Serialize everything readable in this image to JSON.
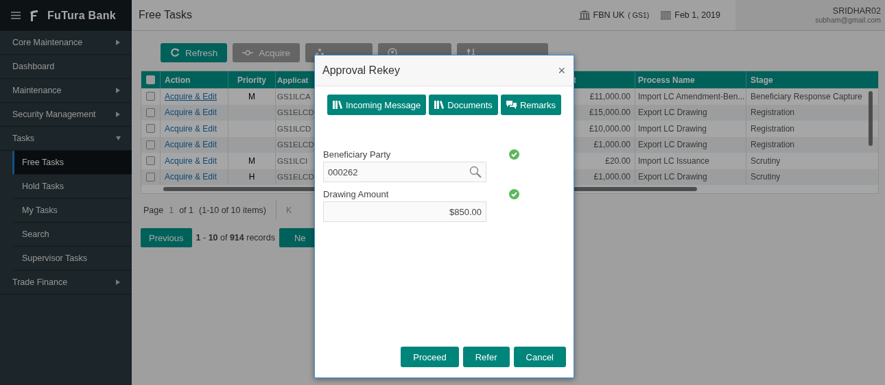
{
  "brand": {
    "name": "FuTura Bank"
  },
  "sidebar": {
    "items": [
      {
        "label": "Core Maintenance",
        "expanded": false
      },
      {
        "label": "Dashboard"
      },
      {
        "label": "Maintenance",
        "expanded": false
      },
      {
        "label": "Security Management",
        "expanded": false
      },
      {
        "label": "Tasks",
        "expanded": true,
        "children": [
          {
            "label": "Free Tasks",
            "selected": true
          },
          {
            "label": "Hold Tasks",
            "selected": false
          },
          {
            "label": "My Tasks",
            "selected": false
          },
          {
            "label": "Search",
            "selected": false
          },
          {
            "label": "Supervisor Tasks",
            "selected": false
          }
        ]
      },
      {
        "label": "Trade Finance",
        "expanded": false
      }
    ]
  },
  "header": {
    "title": "Free Tasks",
    "branch": "FBN UK",
    "branch_code": "( GS1)",
    "date": "Feb 1, 2019",
    "user": "SRIDHAR02",
    "email": "subham@gmail.com"
  },
  "toolbar": [
    {
      "label": "Refresh",
      "kind": "refresh",
      "disabled": false
    },
    {
      "label": "Acquire",
      "kind": "acquire",
      "disabled": true
    },
    {
      "kind": "delegate",
      "disabled": true
    },
    {
      "kind": "reassign",
      "disabled": true
    },
    {
      "kind": "flow",
      "disabled": true
    }
  ],
  "table": {
    "header_checked": false,
    "columns": [
      "Action",
      "Priority",
      "Applicat",
      "t",
      "Process Name",
      "Stage"
    ],
    "rows": [
      {
        "checked": false,
        "action": "Acquire & Edit",
        "priority": "M",
        "application": "GS1ILCA",
        "amount": "£11,000.00",
        "process": "Import LC Amendment-Ben...",
        "stage": "Beneficiary Response Capture"
      },
      {
        "checked": false,
        "action": "Acquire & Edit",
        "priority": "",
        "application": "GS1ELCD",
        "amount": "£15,000.00",
        "process": "Export LC Drawing",
        "stage": "Registration"
      },
      {
        "checked": false,
        "action": "Acquire & Edit",
        "priority": "",
        "application": "GS1ILCD",
        "amount": "£10,000.00",
        "process": "Import LC Drawing",
        "stage": "Registration"
      },
      {
        "checked": false,
        "action": "Acquire & Edit",
        "priority": "",
        "application": "GS1ELCD",
        "amount": "£1,000.00",
        "process": "Export LC Drawing",
        "stage": "Registration"
      },
      {
        "checked": false,
        "action": "Acquire & Edit",
        "priority": "M",
        "application": "GS1ILCI",
        "amount": "£20.00",
        "process": "Import LC Issuance",
        "stage": "Scrutiny"
      },
      {
        "checked": false,
        "action": "Acquire & Edit",
        "priority": "H",
        "application": "GS1ELCD",
        "amount": "£1,000.00",
        "process": "Export LC Drawing",
        "stage": "Scrutiny"
      }
    ]
  },
  "pager": {
    "page_label": "Page",
    "page": "1",
    "of": "of 1",
    "items": "(1-10 of 10 items)",
    "first": "K"
  },
  "records": {
    "previous": "Previous",
    "summary": "**1** - **10** of **914** records",
    "next": "Ne"
  },
  "dialog": {
    "title": "Approval Rekey",
    "close": "×",
    "actions": [
      {
        "label": "Incoming Message",
        "kind": "library"
      },
      {
        "label": "Documents",
        "kind": "library"
      },
      {
        "label": "Remarks",
        "kind": "chat"
      }
    ],
    "fields": [
      {
        "label": "Beneficiary Party",
        "value": "000262",
        "search": true,
        "verified": true
      },
      {
        "label": "Drawing Amount",
        "value": "$850.00",
        "search": false,
        "verified": true
      }
    ],
    "buttons": [
      "Proceed",
      "Refer",
      "Cancel"
    ]
  }
}
